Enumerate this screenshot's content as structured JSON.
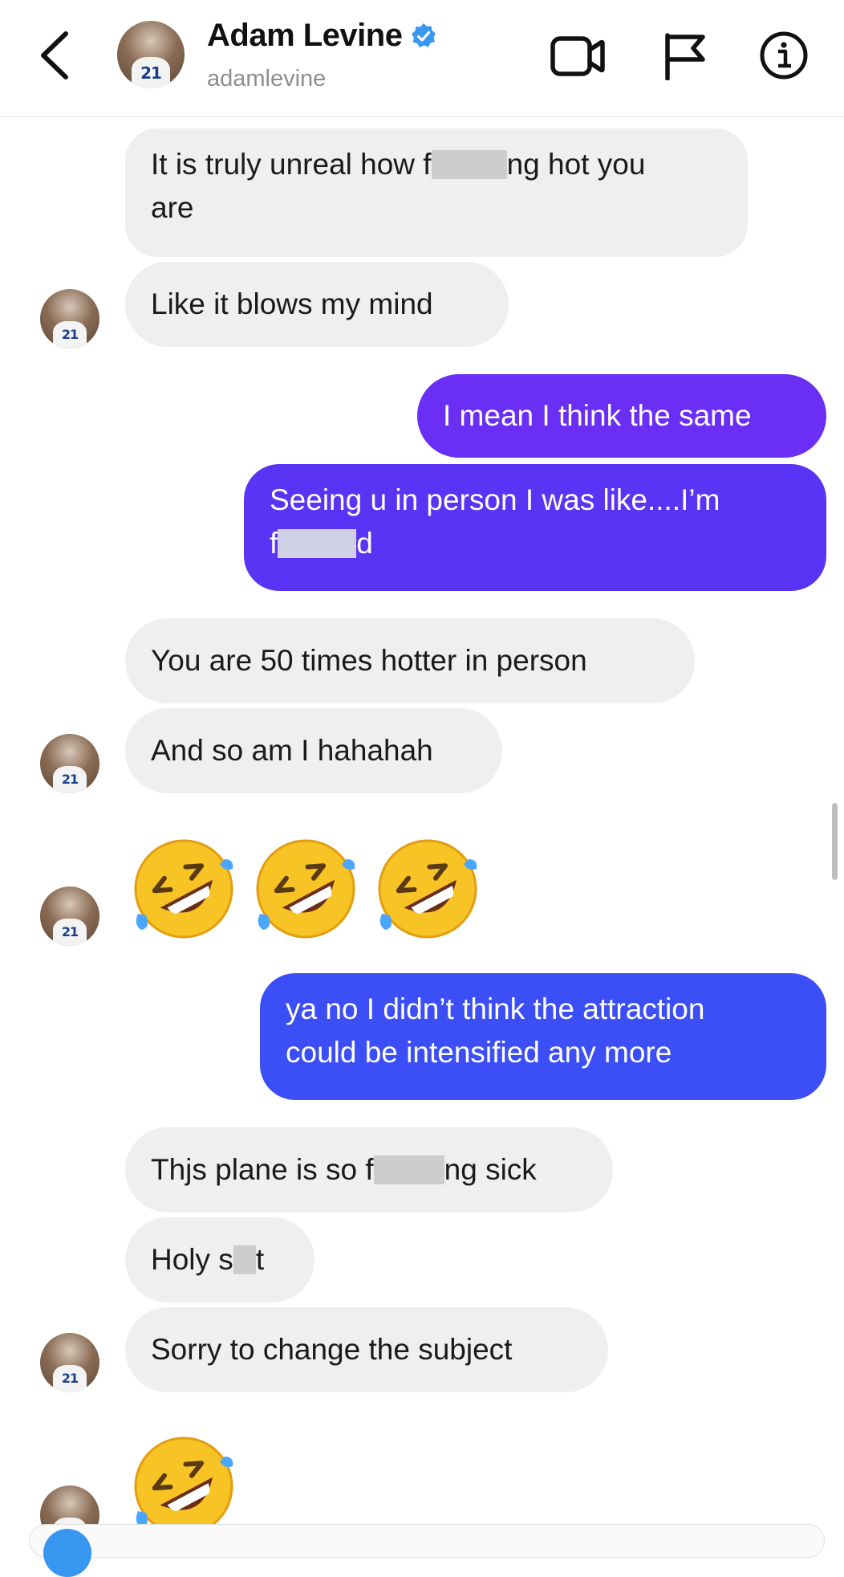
{
  "header": {
    "name": "Adam Levine",
    "handle": "adamlevine",
    "avatar_jersey_number": "21",
    "icons": [
      "back-icon",
      "verified-badge-icon",
      "video-call-icon",
      "flag-icon",
      "info-icon"
    ]
  },
  "colors": {
    "incoming_bubble": "#efefef",
    "outgoing_purple": "#6a2ef5",
    "outgoing_blue": "#3c4ff6",
    "verified_blue": "#3897f0"
  },
  "messages": [
    {
      "from": "them",
      "parts": [
        "It is truly unreal how f",
        "[censored]",
        "ng hot you are"
      ]
    },
    {
      "from": "them",
      "text": "Like it blows my mind"
    },
    {
      "from": "me",
      "text": "I mean I think the same"
    },
    {
      "from": "me",
      "parts": [
        "Seeing u in person I was like....I’m f",
        "[censored]",
        "d"
      ]
    },
    {
      "from": "them",
      "text": "You are 50 times hotter in person"
    },
    {
      "from": "them",
      "text": "And so am I hahahah"
    },
    {
      "from": "them",
      "emoji": "🤣🤣🤣"
    },
    {
      "from": "me",
      "text": "ya no I didn’t think the attraction could be intensified any more"
    },
    {
      "from": "them",
      "parts": [
        "Thjs plane is so f",
        "[censored]",
        "ng sick"
      ]
    },
    {
      "from": "them",
      "parts": [
        "Holy s",
        "[censored]",
        "t"
      ]
    },
    {
      "from": "them",
      "text": "Sorry to change the subject"
    },
    {
      "from": "them",
      "emoji": "🤣"
    }
  ],
  "m1": {
    "a": "It is truly unreal how f",
    "b": "ng hot you",
    "c": "are"
  },
  "m2": "Like it blows my mind",
  "m3": "I mean I think the same",
  "m4": {
    "a": "Seeing u in person I was like....I’m",
    "b": "f",
    "c": "d"
  },
  "m5": "You are 50 times hotter in person",
  "m6": "And so am I hahahah",
  "m8": {
    "a": "ya no I didn’t think the attraction",
    "b": "could be intensified any more"
  },
  "m9": {
    "a": "Thjs plane is so f",
    "b": "ng sick"
  },
  "m10": {
    "a": "Holy s",
    "b": "t"
  },
  "m11": "Sorry to change the subject"
}
